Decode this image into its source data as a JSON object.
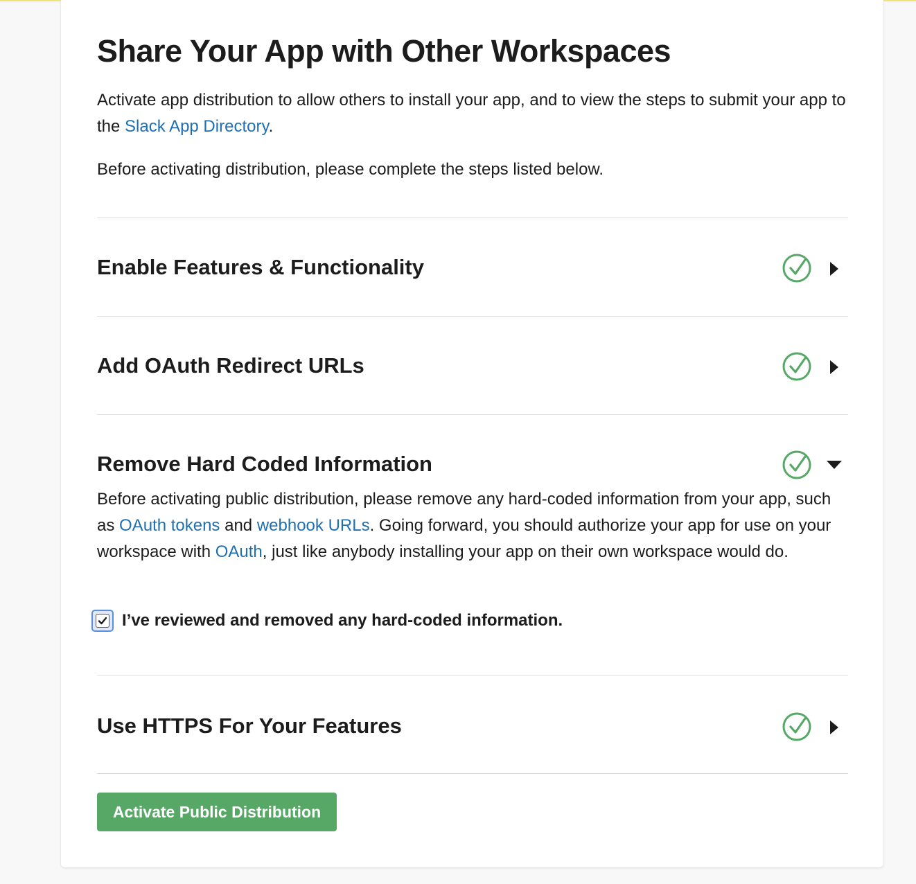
{
  "header": {
    "title": "Share Your App with Other Workspaces",
    "intro_before_link": "Activate app distribution to allow others to install your app, and to view the steps to submit your app to the ",
    "intro_link": "Slack App Directory",
    "intro_after_link": ".",
    "intro_note": "Before activating distribution, please complete the steps listed below."
  },
  "steps": [
    {
      "title": "Enable Features & Functionality",
      "status": "complete",
      "expanded": false
    },
    {
      "title": "Add OAuth Redirect URLs",
      "status": "complete",
      "expanded": false
    },
    {
      "title": "Remove Hard Coded Information",
      "status": "complete",
      "expanded": true,
      "body": {
        "part1": "Before activating public distribution, please remove any hard-coded information from your app, such as ",
        "link1": "OAuth tokens",
        "part2": " and ",
        "link2": "webhook URLs",
        "part3": ". Going forward, you should authorize your app for use on your workspace with ",
        "link3": "OAuth",
        "part4": ", just like anybody installing your app on their own workspace would do."
      },
      "confirm_label": "I’ve reviewed and removed any hard-coded information.",
      "confirm_checked": true
    },
    {
      "title": "Use HTTPS For Your Features",
      "status": "complete",
      "expanded": false
    }
  ],
  "actions": {
    "activate_label": "Activate Public Distribution"
  },
  "colors": {
    "accent_link": "#1f6fb2",
    "success_green": "#57a867",
    "top_accent": "#f2e27a"
  },
  "icons": {
    "complete": "check-circle-icon",
    "collapsed": "caret-right-icon",
    "expanded": "caret-down-icon"
  }
}
